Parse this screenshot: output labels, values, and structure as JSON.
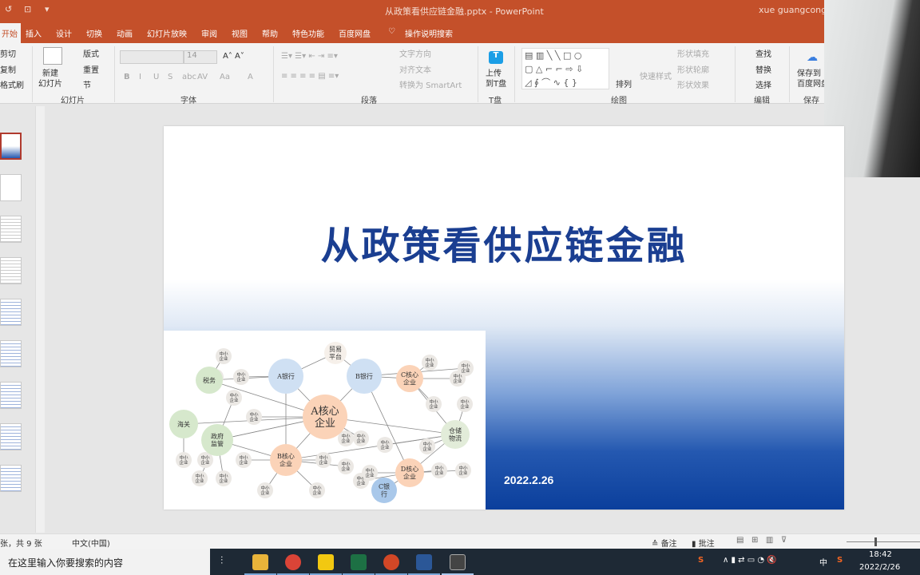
{
  "window": {
    "title": "从政策看供应链金融.pptx - PowerPoint",
    "user": "xue guangcong"
  },
  "tabs": [
    "开始",
    "插入",
    "设计",
    "切换",
    "动画",
    "幻灯片放映",
    "审阅",
    "视图",
    "帮助",
    "特色功能",
    "百度网盘",
    "操作说明搜索"
  ],
  "ribbon": {
    "clipboard": [
      "剪切",
      "复制",
      "格式刷"
    ],
    "slides": {
      "new": "新建\n幻灯片",
      "layout": "版式",
      "reset": "重置",
      "section": "节",
      "label": "幻灯片"
    },
    "font": {
      "size": "14",
      "label": "字体",
      "buttons": [
        "B",
        "I",
        "U",
        "S",
        "abc",
        "AV",
        "Aa",
        "A"
      ]
    },
    "paragraph": {
      "label": "段落",
      "text_direction": "文字方向",
      "align_text": "对齐文本",
      "smartart": "转换为 SmartArt"
    },
    "tdisk": {
      "upload": "上传\n到T盘",
      "label": "T盘"
    },
    "drawing": {
      "arrange": "排列",
      "quick_styles": "快速样式",
      "fill": "形状填充",
      "outline": "形状轮廓",
      "effects": "形状效果",
      "label": "绘图"
    },
    "editing": {
      "find": "查找",
      "replace": "替换",
      "select": "选择",
      "label": "编辑"
    },
    "save": {
      "button": "保存到\n百度网盘",
      "label": "保存"
    }
  },
  "slide": {
    "title": "从政策看供应链金融",
    "date": "2022.2.26",
    "diagram": {
      "nodes": [
        "A银行",
        "B银行",
        "A核心\n企业",
        "B核心\n企业",
        "C核心\n企业",
        "D核心\n企业",
        "C银\n行",
        "税务",
        "海关",
        "政府\n监管",
        "仓储\n物流",
        "贸易\n平台"
      ],
      "small_node": "中小\n企业"
    }
  },
  "status": {
    "slide_count": "张，共 9 张",
    "language": "中文(中国)",
    "notes": "备注",
    "comments": "批注"
  },
  "taskbar": {
    "search_placeholder": "在这里输入你要搜索的内容",
    "time": "18:42",
    "date": "2022/2/26",
    "ime": "中"
  },
  "colors": {
    "accent": "#c4502a",
    "title": "#1a3e91",
    "slide_blue": "#0b3f9c"
  }
}
